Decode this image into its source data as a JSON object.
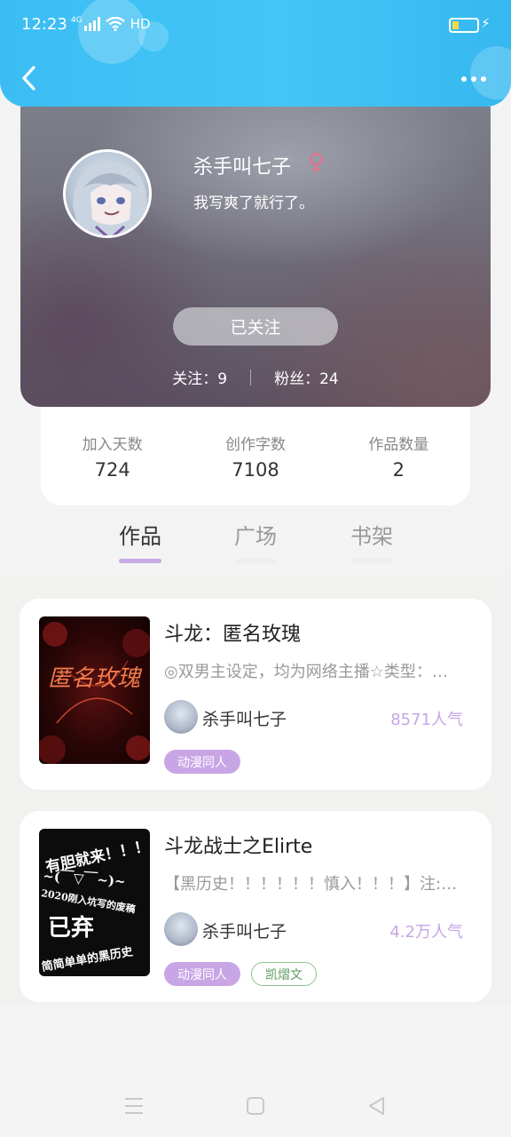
{
  "status_bar": {
    "time": "12:23",
    "network": "4G",
    "hd_label": "HD"
  },
  "profile": {
    "nickname": "杀手叫七子",
    "gender_symbol": "♀",
    "bio": "我写爽了就行了。",
    "follow_button": "已关注",
    "following_text": "关注：9",
    "fans_text": "粉丝：24"
  },
  "stats": [
    {
      "label": "加入天数",
      "value": "724"
    },
    {
      "label": "创作字数",
      "value": "7108"
    },
    {
      "label": "作品数量",
      "value": "2"
    }
  ],
  "tabs": [
    {
      "label": "作品",
      "active": true
    },
    {
      "label": "广场",
      "active": false
    },
    {
      "label": "书架",
      "active": false
    }
  ],
  "works": [
    {
      "title": "斗龙：匿名玫瑰",
      "description": "◎双男主设定，均为网络主播☆类型：…",
      "author": "杀手叫七子",
      "popularity": "8571人气",
      "tags": [
        "动漫同人"
      ],
      "cover_text": "匿名玫瑰"
    },
    {
      "title": "斗龙战士之Elirte",
      "description": "【黑历史！！！！！！慎入！！！】注:…",
      "author": "杀手叫七子",
      "popularity": "4.2万人气",
      "tags": [
        "动漫同人",
        "凯熠文"
      ],
      "cover_lines": [
        "有胆就来！！！",
        "~(￣▽￣~)~",
        "2020刚入坑写的废稿",
        "已弃",
        "简简单单的黑历史"
      ]
    }
  ],
  "colors": {
    "header": "#3bbdf3",
    "accent_purple": "#c8a6e6",
    "tag_green": "#8fc48e",
    "gender": "#e2738e"
  }
}
